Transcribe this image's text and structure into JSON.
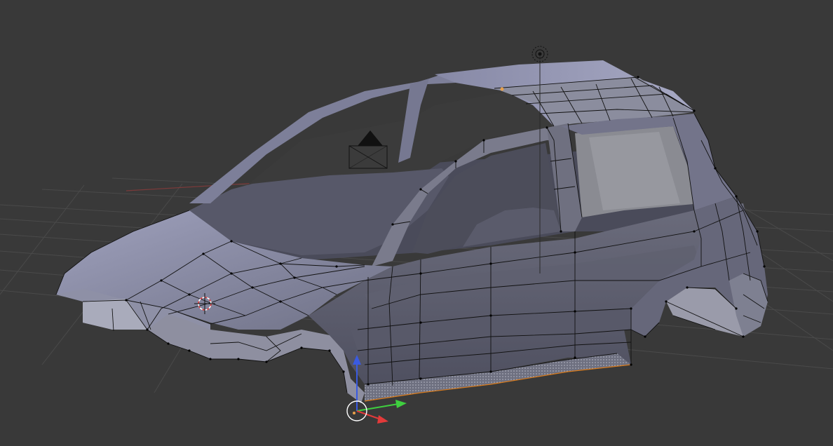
{
  "viewport": {
    "background": "#393939",
    "grid_color": "#4a4a4a"
  },
  "mesh": {
    "body_color": "#5c5d6e",
    "highlight_color": "#a9abc6",
    "selected_face_color": "#8d8f9c",
    "edge_color": "#111111",
    "selected_edge_color": "#d97a1a"
  },
  "gizmo": {
    "x_color": "#e33a3a",
    "y_color": "#3fcf3f",
    "z_color": "#3a5be0"
  },
  "icons": [
    "3d-cursor-icon",
    "lamp-icon",
    "camera-icon",
    "object-origin-icon",
    "transform-manipulator-icon"
  ]
}
